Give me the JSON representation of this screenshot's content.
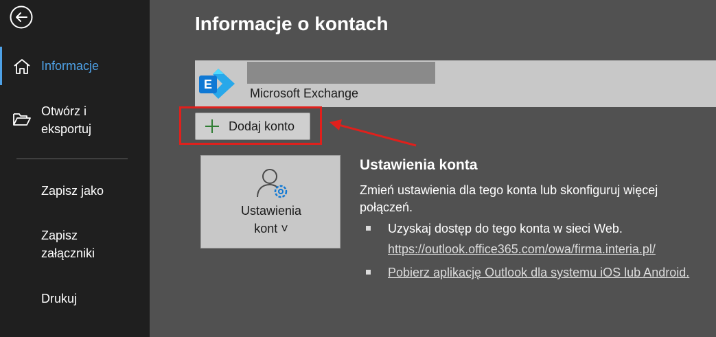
{
  "sidebar": {
    "items": [
      {
        "label": "Informacje"
      },
      {
        "label_line1": "Otwórz i",
        "label_line2": "eksportuj"
      },
      {
        "label": "Zapisz jako"
      },
      {
        "label_line1": "Zapisz",
        "label_line2": "załączniki"
      },
      {
        "label": "Drukuj"
      }
    ]
  },
  "main": {
    "title": "Informacje o kontach",
    "account": {
      "type": "Microsoft Exchange",
      "logo_letter": "E"
    },
    "add_account_label": "Dodaj konto",
    "settings_tile": {
      "line1": "Ustawienia",
      "line2": "kont ˅"
    },
    "info": {
      "title": "Ustawienia konta",
      "desc": "Zmień ustawienia dla tego konta lub skonfiguruj więcej połączeń.",
      "bullet1": "Uzyskaj dostęp do tego konta w sieci Web.",
      "link1": "https://outlook.office365.com/owa/firma.interia.pl/",
      "link2": "Pobierz aplikację Outlook dla systemu iOS lub Android."
    }
  },
  "colors": {
    "accent": "#4ea1e6",
    "highlight": "#e0201c",
    "exchange_blue": "#0f78d4"
  },
  "icons": [
    "back-arrow-icon",
    "home-icon",
    "folder-open-icon",
    "plus-icon",
    "account-settings-icon",
    "exchange-logo-icon"
  ]
}
